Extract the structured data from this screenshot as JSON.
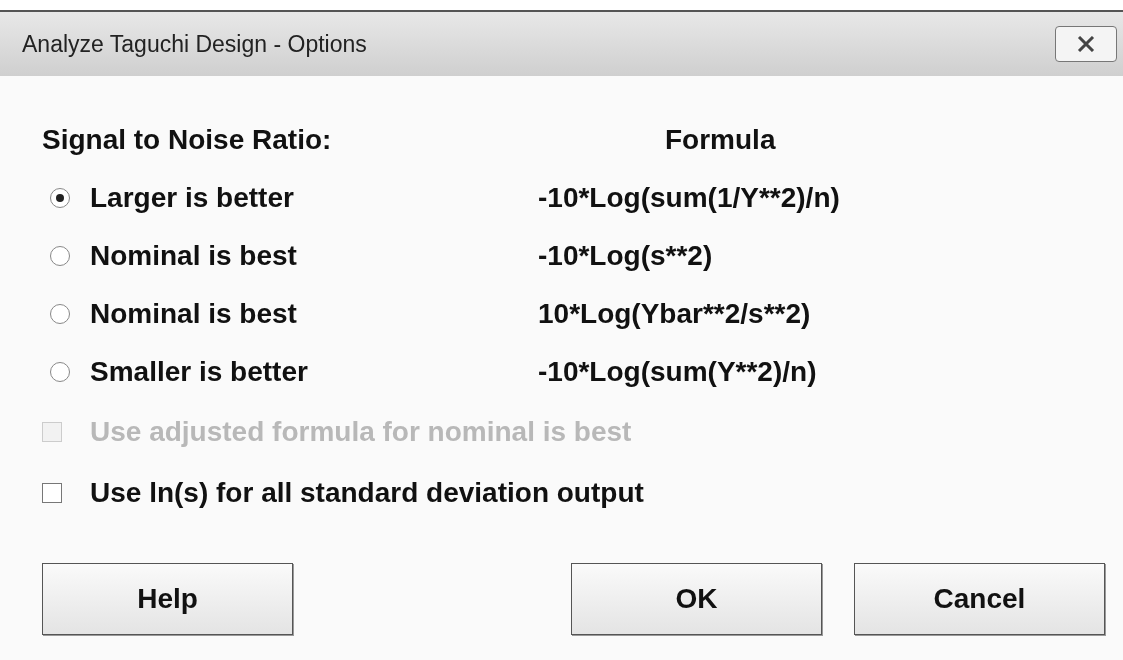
{
  "window": {
    "title": "Analyze Taguchi Design - Options"
  },
  "header": {
    "label": "Signal to Noise Ratio:",
    "formula_heading": "Formula"
  },
  "options": [
    {
      "label": "Larger is better",
      "formula": "-10*Log(sum(1/Y**2)/n)",
      "selected": true
    },
    {
      "label": "Nominal is best",
      "formula": "-10*Log(s**2)",
      "selected": false
    },
    {
      "label": "Nominal is best",
      "formula": "10*Log(Ybar**2/s**2)",
      "selected": false
    },
    {
      "label": "Smaller is better",
      "formula": "-10*Log(sum(Y**2)/n)",
      "selected": false
    }
  ],
  "checkboxes": [
    {
      "label": "Use adjusted formula for nominal is best",
      "checked": false,
      "disabled": true
    },
    {
      "label": "Use ln(s) for all standard deviation output",
      "checked": false,
      "disabled": false
    }
  ],
  "buttons": [
    "Help",
    "OK",
    "Cancel"
  ]
}
